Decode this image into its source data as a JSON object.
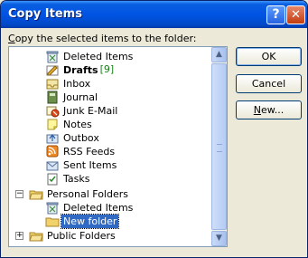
{
  "window": {
    "title": "Copy Items",
    "help_symbol": "?",
    "close_symbol": "✕"
  },
  "prompt": {
    "label_hotkey": "C",
    "label_rest": "opy the selected items to the folder:"
  },
  "tree": {
    "items": [
      {
        "label": "Deleted Items",
        "icon": "deleted-items-icon"
      },
      {
        "label": "Drafts",
        "count": "[9]",
        "icon": "drafts-icon"
      },
      {
        "label": "Inbox",
        "icon": "inbox-icon"
      },
      {
        "label": "Journal",
        "icon": "journal-icon"
      },
      {
        "label": "Junk E-Mail",
        "icon": "junk-email-icon"
      },
      {
        "label": "Notes",
        "icon": "notes-icon"
      },
      {
        "label": "Outbox",
        "icon": "outbox-icon"
      },
      {
        "label": "RSS Feeds",
        "icon": "rss-feeds-icon"
      },
      {
        "label": "Sent Items",
        "icon": "sent-items-icon"
      },
      {
        "label": "Tasks",
        "icon": "tasks-icon"
      },
      {
        "label": "Personal Folders",
        "icon": "personal-folders-icon",
        "expander": "−"
      },
      {
        "label": "Deleted Items",
        "icon": "deleted-items-icon"
      },
      {
        "label": "New folder",
        "icon": "folder-icon"
      },
      {
        "label": "Public Folders",
        "icon": "public-folders-icon",
        "expander": "+"
      }
    ],
    "scroll_up": "▲",
    "scroll_down": "▼"
  },
  "buttons": {
    "ok": "OK",
    "cancel": "Cancel",
    "new_hotkey": "N",
    "new_rest": "ew..."
  },
  "colors": {
    "title_bar": "#0054e3",
    "selection": "#316ac5",
    "count": "#1a7f1a"
  }
}
